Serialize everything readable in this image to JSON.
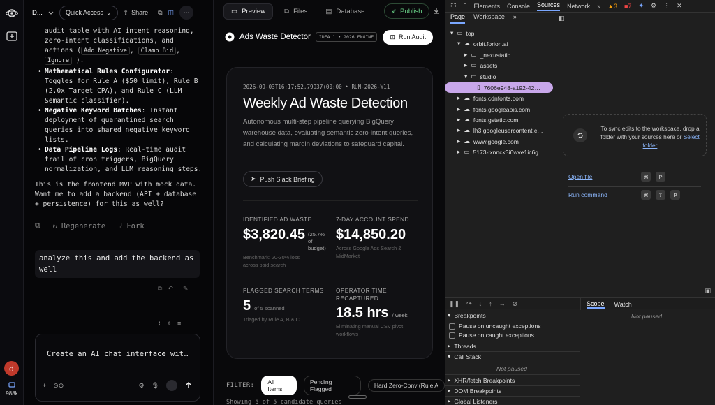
{
  "chat": {
    "project_initial": "D...",
    "quick_access": "Quick Access",
    "share": "Share",
    "lines_top": [
      "audit table with AI intent reasoning,",
      "zero-intent classifications, and"
    ],
    "actions_prefix": "actions (",
    "chip_add_negative": "Add Negative",
    "chip_clamp_bid": "Clamp Bid",
    "chip_ignore": "Ignore",
    "actions_suffix": ").",
    "bullets": [
      {
        "title": "Mathematical Rules Configurator",
        "text": ": Toggles for Rule A ($50 limit), Rule B (2.0x Target CPA), and Rule C (LLM Semantic classifier)."
      },
      {
        "title": "Negative Keyword Batches",
        "text": ": Instant deployment of quarantined search queries into shared negative keyword lists."
      },
      {
        "title": "Data Pipeline Logs",
        "text": ": Real-time audit trail of cron triggers, BigQuery normalization, and LLM reasoning steps."
      }
    ],
    "closing": "This is the frontend MVP with mock data. Want me to add a backend (API + database + persistence) for this as well?",
    "regenerate": "Regenerate",
    "fork": "Fork",
    "user_message": "analyze this and add the backend as well",
    "composer_text": "Create an AI chat interface wit…",
    "avatar_letter": "d",
    "credits": "988k"
  },
  "preview": {
    "tabs": [
      "Preview",
      "Files",
      "Database"
    ],
    "publish": "Publish",
    "app_name": "Ads Waste Detector",
    "app_tag": "IDEA 1 • 2026 ENGINE",
    "run_audit": "Run Audit",
    "timestamp": "2026-09-03T16:17:52.79937+00:00 • RUN-2026-W11",
    "title": "Weekly Ad Waste Detection",
    "description": "Autonomous multi-step pipeline querying BigQuery warehouse data, evaluating semantic zero-intent queries, and calculating margin deviations to safeguard capital.",
    "slack_button": "Push Slack Briefing",
    "stats": {
      "waste_label": "IDENTIFIED AD WASTE",
      "waste_value": "$3,820.45",
      "waste_pct": "(25.7% of budget)",
      "waste_sub": "Benchmark: 20-30% loss across paid search",
      "spend_label": "7-DAY ACCOUNT SPEND",
      "spend_value": "$14,850.20",
      "spend_sub": "Across Google Ads Search & MidMarket",
      "flagged_label": "FLAGGED SEARCH TERMS",
      "flagged_value": "5",
      "flagged_of": "of 5 scanned",
      "flagged_sub": "Triaged by Rule A, B & C",
      "time_label": "OPERATOR TIME RECAPTURED",
      "time_value": "18.5 hrs",
      "time_unit": "/ week",
      "time_sub": "Eliminating manual CSV pivot workflows"
    },
    "filter_label": "FILTER:",
    "filters": [
      "All Items",
      "Pending Flagged",
      "Hard Zero-Conv (Rule A"
    ],
    "showing": "Showing 5 of 5 candidate queries"
  },
  "devtools": {
    "tabs": [
      "Elements",
      "Console",
      "Sources",
      "Network"
    ],
    "warn_count": "3",
    "err_count": "7",
    "sub_tabs": [
      "Page",
      "Workspace"
    ],
    "tree": [
      "top",
      "orbit.forion.ai",
      "_next/static",
      "assets",
      "studio",
      "7606e948-a192-42…",
      "fonts.cdnfonts.com",
      "fonts.googleapis.com",
      "fonts.gstatic.com",
      "lh3.googleusercontent.c…",
      "www.google.com",
      "5173-ixnnck3i6wve1ic6g…"
    ],
    "sync_text": "To sync edits to the workspace, drop a folder with your sources here or",
    "select_folder": "Select folder",
    "open_file": "Open file",
    "run_command": "Run command",
    "key_p": "P",
    "scope": "Scope",
    "watch": "Watch",
    "not_paused": "Not paused",
    "breakpoints": "Breakpoints",
    "pause_uncaught": "Pause on uncaught exceptions",
    "pause_caught": "Pause on caught exceptions",
    "threads": "Threads",
    "call_stack": "Call Stack",
    "xhr": "XHR/fetch Breakpoints",
    "dom": "DOM Breakpoints",
    "global": "Global Listeners"
  }
}
